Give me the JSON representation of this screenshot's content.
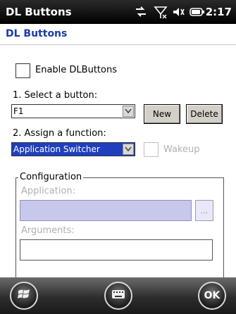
{
  "statusbar": {
    "title": "DL Buttons",
    "time": "2:17",
    "icons": [
      "connectivity-icon",
      "signal-icon",
      "volume-icon",
      "battery-icon"
    ]
  },
  "header": {
    "title": "DL Buttons"
  },
  "form": {
    "enable_label": "Enable DLButtons",
    "enable_checked": false,
    "select_label": "1. Select a button:",
    "button_value": "F1",
    "new_label": "New",
    "delete_label": "Delete",
    "assign_label": "2. Assign a function:",
    "function_value": "Application Switcher",
    "wakeup_label": "Wakeup",
    "wakeup_checked": false
  },
  "config": {
    "title": "Configuration",
    "application_label": "Application:",
    "application_value": "",
    "browse_label": "...",
    "arguments_label": "Arguments:",
    "arguments_value": ""
  },
  "bottombar": {
    "start_icon": "windows-start-icon",
    "keyboard_icon": "keyboard-icon",
    "ok_label": "OK"
  },
  "colors": {
    "header_text": "#1a3aa8",
    "selection": "#1f3fbf",
    "disabled_field": "#c8c8ec"
  }
}
